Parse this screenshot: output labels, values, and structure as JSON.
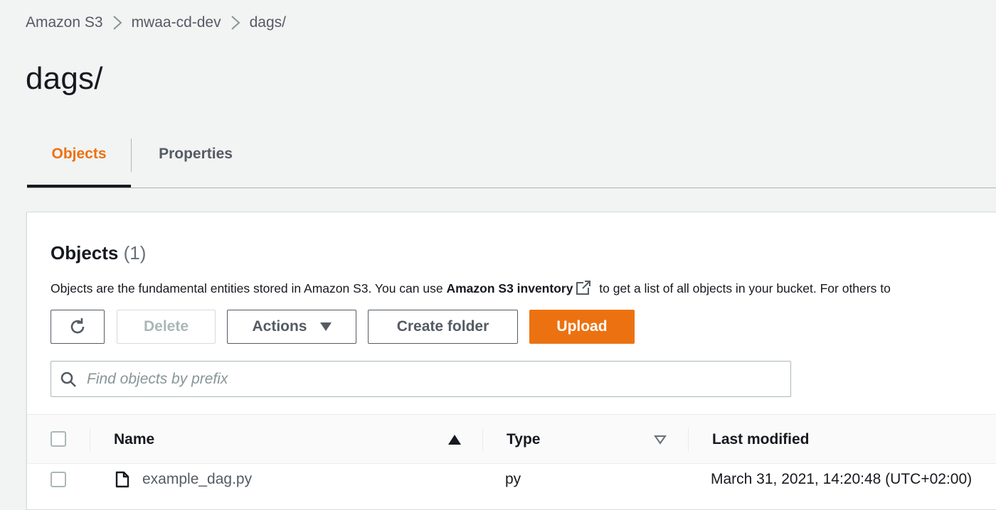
{
  "breadcrumb": {
    "items": [
      "Amazon S3",
      "mwaa-cd-dev",
      "dags/"
    ]
  },
  "page": {
    "title": "dags/"
  },
  "tabs": [
    {
      "label": "Objects",
      "active": true
    },
    {
      "label": "Properties",
      "active": false
    }
  ],
  "objects_panel": {
    "heading": "Objects",
    "count": "(1)",
    "description_start": "Objects are the fundamental entities stored in Amazon S3. You can use ",
    "description_link": "Amazon S3 inventory",
    "description_end": " to get a list of all objects in your bucket. For others to"
  },
  "toolbar": {
    "refresh_icon": "refresh-icon",
    "delete_label": "Delete",
    "actions_label": "Actions",
    "create_folder_label": "Create folder",
    "upload_label": "Upload"
  },
  "search": {
    "placeholder": "Find objects by prefix",
    "value": ""
  },
  "table": {
    "columns": [
      "Name",
      "Type",
      "Last modified"
    ],
    "rows": [
      {
        "name": "example_dag.py",
        "type": "py",
        "last_modified": "March 31, 2021, 14:20:48 (UTC+02:00)"
      }
    ]
  },
  "colors": {
    "accent": "#ec7211",
    "text": "#16191f",
    "muted": "#545b64",
    "background": "#f2f3f3"
  }
}
